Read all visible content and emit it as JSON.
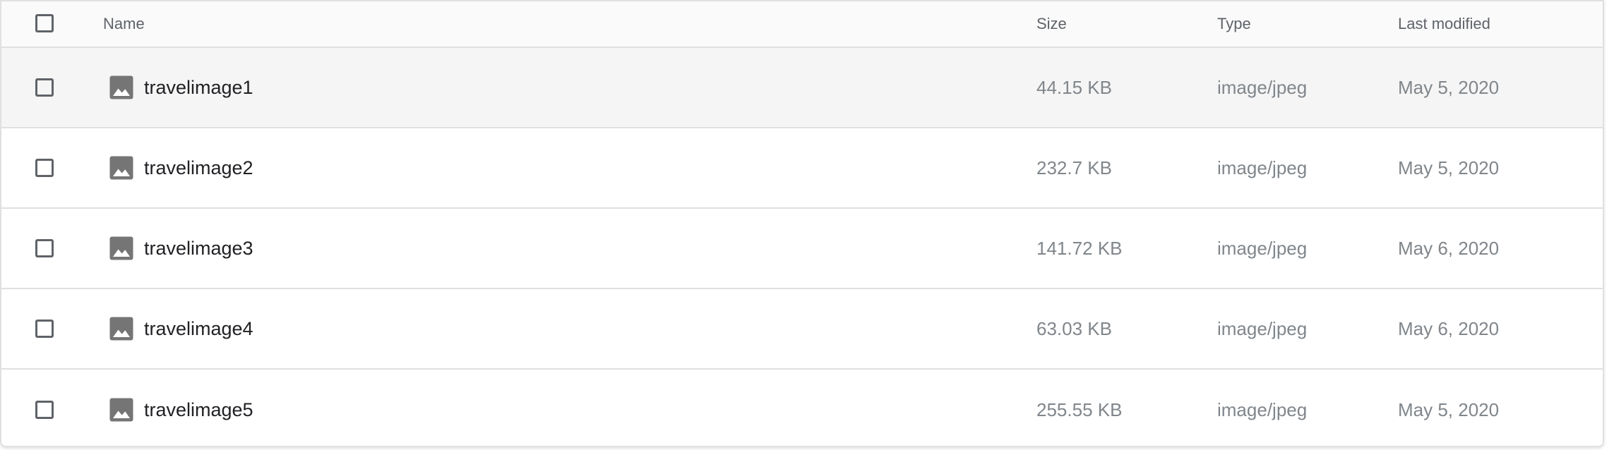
{
  "columns": {
    "name": "Name",
    "size": "Size",
    "type": "Type",
    "modified": "Last modified"
  },
  "files": [
    {
      "name": "travelimage1",
      "size": "44.15 KB",
      "type": "image/jpeg",
      "modified": "May 5, 2020",
      "icon": "image-icon",
      "highlighted": true
    },
    {
      "name": "travelimage2",
      "size": "232.7 KB",
      "type": "image/jpeg",
      "modified": "May 5, 2020",
      "icon": "image-icon"
    },
    {
      "name": "travelimage3",
      "size": "141.72 KB",
      "type": "image/jpeg",
      "modified": "May 6, 2020",
      "icon": "image-icon"
    },
    {
      "name": "travelimage4",
      "size": "63.03 KB",
      "type": "image/jpeg",
      "modified": "May 6, 2020",
      "icon": "image-icon"
    },
    {
      "name": "travelimage5",
      "size": "255.55 KB",
      "type": "image/jpeg",
      "modified": "May 5, 2020",
      "icon": "image-icon"
    }
  ],
  "colors": {
    "icon": "#757575",
    "row_highlight": "#f5f5f5",
    "header_bg": "#fafafa",
    "divider": "#e0e0e0"
  }
}
